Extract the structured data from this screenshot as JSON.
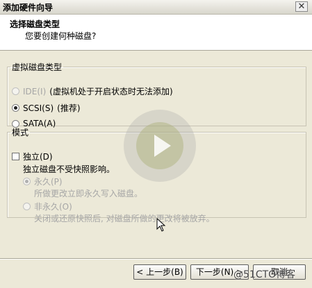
{
  "window": {
    "title": "添加硬件向导",
    "close_icon": "close-icon"
  },
  "header": {
    "title": "选择磁盘类型",
    "subtitle": "您要创建何种磁盘?"
  },
  "disk_type": {
    "legend": "虚拟磁盘类型",
    "options": [
      {
        "label": "IDE(I)",
        "note": "(虚拟机处于开启状态时无法添加)",
        "state": "disabled"
      },
      {
        "label": "SCSI(S)",
        "note": "(推荐)",
        "state": "selected"
      },
      {
        "label": "SATA(A)",
        "note": "",
        "state": "unselected"
      }
    ]
  },
  "mode": {
    "legend": "模式",
    "independent_label": "独立(D)",
    "independent_checked": false,
    "description": "独立磁盘不受快照影响。",
    "persistent_label": "永久(P)",
    "persistent_desc": "所做更改立即永久写入磁盘。",
    "nonpersistent_label": "非永久(O)",
    "nonpersistent_desc": "关闭或还原快照后, 对磁盘所做的更改将被放弃。"
  },
  "buttons": {
    "back": "< 上一步(B)",
    "next": "下一步(N) >",
    "cancel": "取消"
  },
  "overlay": {
    "play_icon": "play-icon",
    "watermark": "@51CTO博客"
  }
}
